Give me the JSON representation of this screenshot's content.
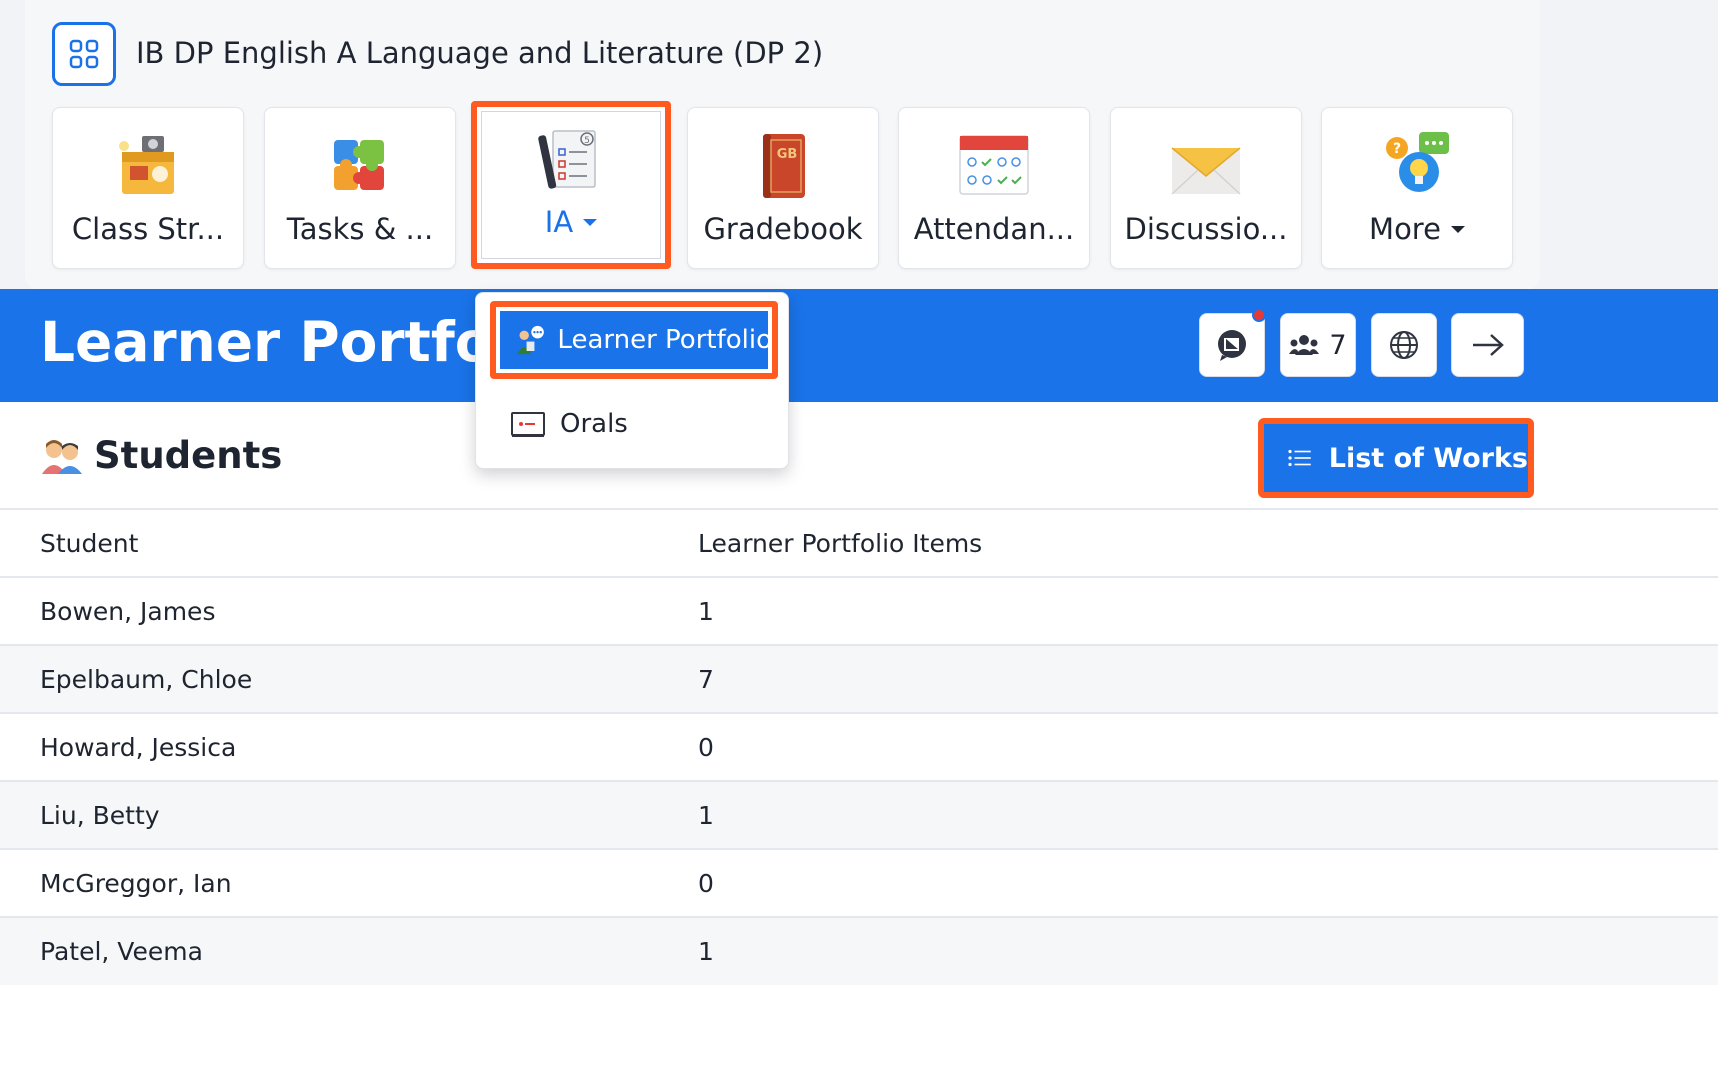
{
  "course": {
    "title": "IB DP English A Language and Literature (DP 2)"
  },
  "tiles": [
    {
      "label": "Class Str...",
      "icon": "class-stream-icon"
    },
    {
      "label": "Tasks & ...",
      "icon": "puzzle-icon"
    },
    {
      "label": "IA",
      "icon": "ia-checklist-icon"
    },
    {
      "label": "Gradebook",
      "icon": "gradebook-icon"
    },
    {
      "label": "Attendan...",
      "icon": "attendance-calendar-icon"
    },
    {
      "label": "Discussio...",
      "icon": "envelope-icon"
    },
    {
      "label": "More",
      "icon": "lightbulb-chat-icon"
    }
  ],
  "header": {
    "title": "Learner Portfolio",
    "members_count": "7"
  },
  "dropdown": {
    "items": [
      {
        "label": "Learner Portfolio",
        "icon": "learner-portfolio-icon"
      },
      {
        "label": "Orals",
        "icon": "rec-screen-icon"
      }
    ]
  },
  "section": {
    "title": "Students",
    "list_button": "List of Works"
  },
  "table": {
    "columns": [
      "Student",
      "Learner Portfolio Items"
    ],
    "rows": [
      [
        "Bowen, James",
        "1"
      ],
      [
        "Epelbaum, Chloe",
        "7"
      ],
      [
        "Howard, Jessica",
        "0"
      ],
      [
        "Liu, Betty",
        "1"
      ],
      [
        "McGreggor, Ian",
        "0"
      ],
      [
        "Patel, Veema",
        "1"
      ]
    ]
  },
  "colors": {
    "accent": "#1a73e8",
    "highlight": "#ff5a1f"
  }
}
